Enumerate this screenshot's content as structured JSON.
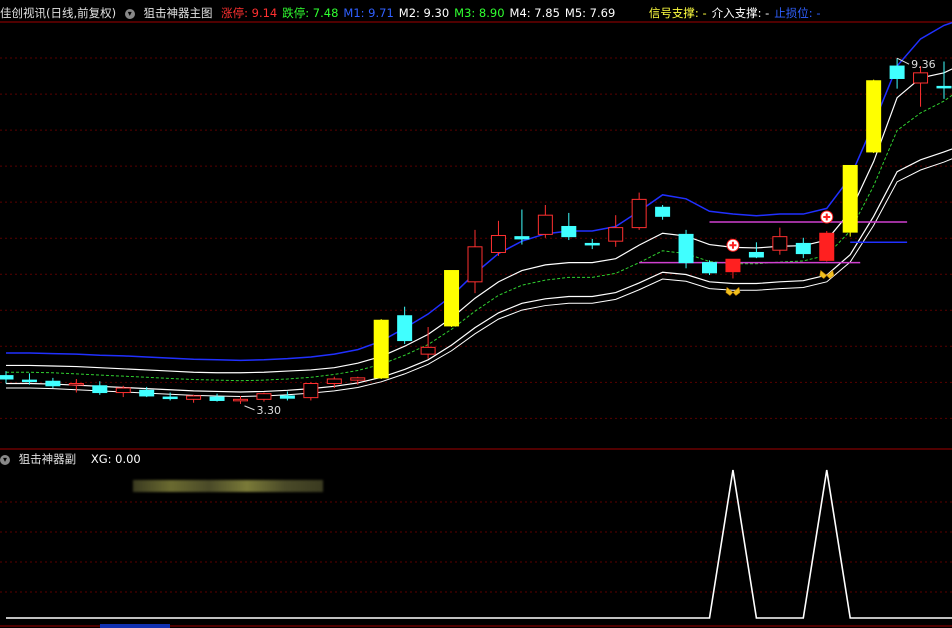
{
  "header_main": {
    "title": "佳创视讯(日线,前复权)",
    "indicator_name": "狙击神器主图",
    "items": [
      {
        "label": "涨停: ",
        "value": "9.14",
        "color": "#ff3030"
      },
      {
        "label": "跌停: ",
        "value": "7.48",
        "color": "#30ff30"
      },
      {
        "label": "M1: ",
        "value": "9.71",
        "color": "#3060ff"
      },
      {
        "label": "M2: ",
        "value": "9.30",
        "color": "#ffffff"
      },
      {
        "label": "M3: ",
        "value": "8.90",
        "color": "#30ff30"
      },
      {
        "label": "M4: ",
        "value": "7.85",
        "color": "#ffffff"
      },
      {
        "label": "M5: ",
        "value": "7.69",
        "color": "#ffffff"
      }
    ],
    "signals": [
      {
        "label": "信号支撑: -",
        "color": "#ffff40"
      },
      {
        "label": "介入支撑: -",
        "color": "#ffffff"
      },
      {
        "label": "止损位: -",
        "color": "#3060ff"
      }
    ]
  },
  "header_sub": {
    "indicator_name": "狙击神器副",
    "xg_label": "XG: 0.00",
    "xg_color": "#ffffff"
  },
  "annotations": {
    "high": "9.36",
    "low": "3.30"
  },
  "colors": {
    "up": "#ff3030",
    "down": "#40ffff",
    "breakout": "#ffff00",
    "signal_red": "#ff2020",
    "band_outer": "#2030ff",
    "band_white": "#ffffff",
    "band_green": "#30d030",
    "grid": "#5a0000",
    "support_magenta": "#d040d0",
    "xg_line": "#ffffff"
  },
  "chart_data": {
    "type": "candlestick",
    "ylim": [
      2.6,
      10.0
    ],
    "candles": [
      {
        "o": 3.74,
        "h": 3.82,
        "l": 3.6,
        "c": 3.68
      },
      {
        "o": 3.66,
        "h": 3.78,
        "l": 3.58,
        "c": 3.64
      },
      {
        "o": 3.64,
        "h": 3.7,
        "l": 3.52,
        "c": 3.56
      },
      {
        "o": 3.58,
        "h": 3.68,
        "l": 3.44,
        "c": 3.6
      },
      {
        "o": 3.56,
        "h": 3.64,
        "l": 3.4,
        "c": 3.44
      },
      {
        "o": 3.44,
        "h": 3.56,
        "l": 3.36,
        "c": 3.52
      },
      {
        "o": 3.48,
        "h": 3.54,
        "l": 3.36,
        "c": 3.38
      },
      {
        "o": 3.36,
        "h": 3.44,
        "l": 3.3,
        "c": 3.34
      },
      {
        "o": 3.32,
        "h": 3.4,
        "l": 3.26,
        "c": 3.38
      },
      {
        "o": 3.36,
        "h": 3.42,
        "l": 3.28,
        "c": 3.3
      },
      {
        "o": 3.31,
        "h": 3.38,
        "l": 3.24,
        "c": 3.32
      },
      {
        "o": 3.32,
        "h": 3.44,
        "l": 3.28,
        "c": 3.42
      },
      {
        "o": 3.38,
        "h": 3.46,
        "l": 3.3,
        "c": 3.34
      },
      {
        "o": 3.35,
        "h": 3.62,
        "l": 3.3,
        "c": 3.6
      },
      {
        "o": 3.6,
        "h": 3.72,
        "l": 3.52,
        "c": 3.68
      },
      {
        "o": 3.66,
        "h": 3.72,
        "l": 3.58,
        "c": 3.7
      },
      {
        "o": 3.7,
        "h": 4.74,
        "l": 3.68,
        "c": 4.72,
        "limit": true
      },
      {
        "o": 4.8,
        "h": 4.96,
        "l": 4.3,
        "c": 4.36
      },
      {
        "o": 4.12,
        "h": 4.6,
        "l": 4.04,
        "c": 4.24
      },
      {
        "o": 4.62,
        "h": 5.6,
        "l": 4.6,
        "c": 5.6,
        "limit": true
      },
      {
        "o": 5.4,
        "h": 6.32,
        "l": 5.2,
        "c": 6.02
      },
      {
        "o": 5.92,
        "h": 6.48,
        "l": 5.86,
        "c": 6.22
      },
      {
        "o": 6.2,
        "h": 6.68,
        "l": 6.06,
        "c": 6.16
      },
      {
        "o": 6.24,
        "h": 6.76,
        "l": 6.18,
        "c": 6.58
      },
      {
        "o": 6.38,
        "h": 6.62,
        "l": 6.14,
        "c": 6.2
      },
      {
        "o": 6.08,
        "h": 6.16,
        "l": 5.98,
        "c": 6.06
      },
      {
        "o": 6.12,
        "h": 6.58,
        "l": 6.02,
        "c": 6.36
      },
      {
        "o": 6.36,
        "h": 6.98,
        "l": 6.32,
        "c": 6.86
      },
      {
        "o": 6.72,
        "h": 6.76,
        "l": 6.5,
        "c": 6.56
      },
      {
        "o": 6.24,
        "h": 6.32,
        "l": 5.64,
        "c": 5.74
      },
      {
        "o": 5.74,
        "h": 5.78,
        "l": 5.52,
        "c": 5.56
      },
      {
        "o": 5.58,
        "h": 5.8,
        "l": 5.46,
        "c": 5.8,
        "signal": true
      },
      {
        "o": 5.92,
        "h": 6.1,
        "l": 5.82,
        "c": 5.84
      },
      {
        "o": 5.96,
        "h": 6.36,
        "l": 5.88,
        "c": 6.2
      },
      {
        "o": 6.08,
        "h": 6.18,
        "l": 5.82,
        "c": 5.9
      },
      {
        "o": 5.78,
        "h": 6.3,
        "l": 5.76,
        "c": 6.26,
        "signal": true
      },
      {
        "o": 6.28,
        "h": 7.46,
        "l": 6.2,
        "c": 7.46,
        "limit": true
      },
      {
        "o": 7.7,
        "h": 8.98,
        "l": 7.68,
        "c": 8.96,
        "limit": true
      },
      {
        "o": 9.22,
        "h": 9.36,
        "l": 8.82,
        "c": 9.0
      },
      {
        "o": 8.92,
        "h": 9.22,
        "l": 8.5,
        "c": 9.1
      },
      {
        "o": 8.86,
        "h": 9.3,
        "l": 8.64,
        "c": 8.84
      },
      {
        "o": 8.62,
        "h": 9.32,
        "l": 8.2,
        "c": 9.04
      }
    ],
    "bands": {
      "M1": [
        4.14,
        4.14,
        4.13,
        4.12,
        4.1,
        4.09,
        4.07,
        4.05,
        4.03,
        4.02,
        4.01,
        4.02,
        4.04,
        4.07,
        4.12,
        4.2,
        4.35,
        4.58,
        4.83,
        5.15,
        5.55,
        5.9,
        6.12,
        6.25,
        6.3,
        6.3,
        6.38,
        6.65,
        6.94,
        6.87,
        6.65,
        6.6,
        6.57,
        6.6,
        6.6,
        6.7,
        7.25,
        8.2,
        9.22,
        9.7,
        9.94,
        10.08
      ],
      "M2": [
        3.92,
        3.92,
        3.91,
        3.9,
        3.88,
        3.86,
        3.84,
        3.82,
        3.8,
        3.79,
        3.79,
        3.8,
        3.82,
        3.84,
        3.88,
        3.96,
        4.08,
        4.26,
        4.47,
        4.76,
        5.11,
        5.4,
        5.6,
        5.7,
        5.74,
        5.74,
        5.81,
        6.05,
        6.26,
        6.21,
        6.06,
        6.01,
        6.0,
        6.03,
        6.04,
        6.14,
        6.64,
        7.53,
        8.66,
        9.01,
        9.1,
        9.3
      ],
      "M3": [
        3.8,
        3.8,
        3.79,
        3.77,
        3.75,
        3.73,
        3.71,
        3.69,
        3.67,
        3.66,
        3.65,
        3.66,
        3.68,
        3.71,
        3.76,
        3.83,
        3.94,
        4.1,
        4.29,
        4.56,
        4.88,
        5.16,
        5.34,
        5.43,
        5.48,
        5.48,
        5.55,
        5.74,
        5.95,
        5.9,
        5.76,
        5.72,
        5.72,
        5.75,
        5.77,
        5.87,
        6.3,
        7.1,
        8.08,
        8.39,
        8.6,
        8.9
      ],
      "M4": [
        3.6,
        3.6,
        3.59,
        3.57,
        3.55,
        3.53,
        3.51,
        3.49,
        3.47,
        3.46,
        3.45,
        3.46,
        3.48,
        3.51,
        3.55,
        3.61,
        3.71,
        3.85,
        4.02,
        4.28,
        4.59,
        4.85,
        5.02,
        5.1,
        5.14,
        5.14,
        5.21,
        5.38,
        5.57,
        5.53,
        5.4,
        5.37,
        5.37,
        5.4,
        5.42,
        5.52,
        5.88,
        6.56,
        7.35,
        7.56,
        7.7,
        7.85
      ],
      "M5": [
        3.52,
        3.52,
        3.51,
        3.49,
        3.47,
        3.45,
        3.43,
        3.41,
        3.39,
        3.38,
        3.37,
        3.38,
        3.4,
        3.43,
        3.47,
        3.53,
        3.63,
        3.77,
        3.94,
        4.18,
        4.48,
        4.74,
        4.9,
        4.98,
        5.02,
        5.02,
        5.09,
        5.26,
        5.45,
        5.41,
        5.28,
        5.25,
        5.25,
        5.28,
        5.3,
        5.4,
        5.75,
        6.4,
        7.17,
        7.38,
        7.52,
        7.69
      ]
    },
    "support_lines": [
      {
        "price": 5.74,
        "from": 27,
        "to": 36
      },
      {
        "price": 6.46,
        "from": 30,
        "to": 38
      }
    ],
    "blue_line": {
      "price": 6.1,
      "from": 36,
      "to": 38
    },
    "xg": {
      "ylim": [
        0,
        1
      ],
      "values": [
        0,
        0,
        0,
        0,
        0,
        0,
        0,
        0,
        0,
        0,
        0,
        0,
        0,
        0,
        0,
        0,
        0,
        0,
        0,
        0,
        0,
        0,
        0,
        0,
        0,
        0,
        0,
        0,
        0,
        0,
        0,
        1,
        0,
        0,
        0,
        1,
        0,
        0,
        0,
        0,
        0,
        0
      ]
    }
  }
}
